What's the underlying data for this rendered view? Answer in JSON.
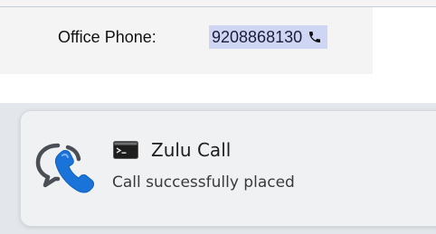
{
  "contact": {
    "phone_label": "Office Phone:",
    "phone_number": "9208868130",
    "phone_icon": "phone-icon",
    "highlight_color": "#cfd6f4"
  },
  "notification": {
    "app_icon": "chat-bubble-phone-icon",
    "title_icon": "terminal-icon",
    "title": "Zulu Call",
    "message": "Call successfully placed",
    "accent_color": "#1a73d9"
  }
}
